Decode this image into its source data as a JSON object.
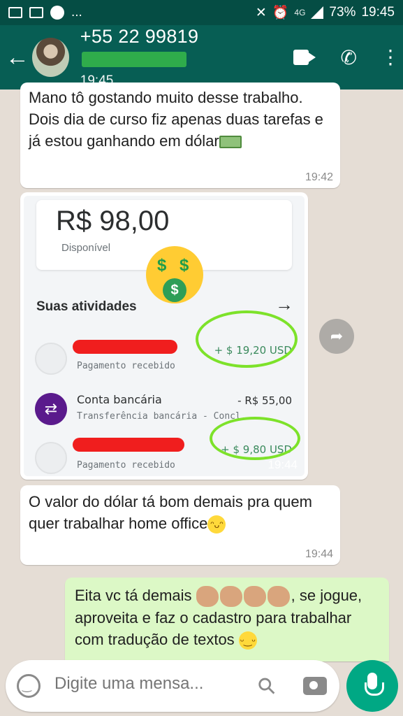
{
  "status_bar": {
    "overflow": "...",
    "network": "4G",
    "battery": "73%",
    "time": "19:45"
  },
  "header": {
    "contact_name": "+55 22 99819",
    "last_seen": "19:45",
    "icons": [
      "back-arrow-icon",
      "avatar",
      "video-call-icon",
      "phone-icon",
      "more-options-icon"
    ]
  },
  "messages": [
    {
      "direction": "in",
      "text": "Mano tô gostando muito desse trabalho. Dois dia de curso fiz apenas duas tarefas e já estou ganhando em dólar",
      "emoji": "money-bill-emoji",
      "time": "19:42"
    },
    {
      "direction": "in",
      "type": "image",
      "time": "19:44",
      "image": {
        "balance": "R$ 98,00",
        "balance_label": "Disponível",
        "activities_title": "Suas atividades",
        "activities": [
          {
            "name": "",
            "subtitle": "Pagamento recebido",
            "amount": "+ $ 19,20 USD"
          },
          {
            "name": "Conta bancária",
            "subtitle": "Transferência bancária - Concl...",
            "amount": "- R$ 55,00"
          },
          {
            "name": "",
            "subtitle": "Pagamento recebido",
            "amount": "+ $ 9,80 USD"
          }
        ]
      }
    },
    {
      "direction": "in",
      "text": "O valor do dólar tá bom demais pra quem quer trabalhar home office",
      "emoji": "grinning-face-emoji",
      "time": "19:44"
    },
    {
      "direction": "out",
      "text_before": "Eita vc tá demais",
      "text_after": ", se jogue, aproveita e faz o cadastro para trabalhar com tradução de textos",
      "emoji": "clapping-hands-emoji"
    }
  ],
  "composer": {
    "placeholder": "Digite uma mensa..."
  },
  "colors": {
    "header": "#075e54",
    "status_bar": "#054d44",
    "outgoing_bubble": "#dcf8c6",
    "incoming_bubble": "#ffffff",
    "mic_button": "#00a884"
  }
}
